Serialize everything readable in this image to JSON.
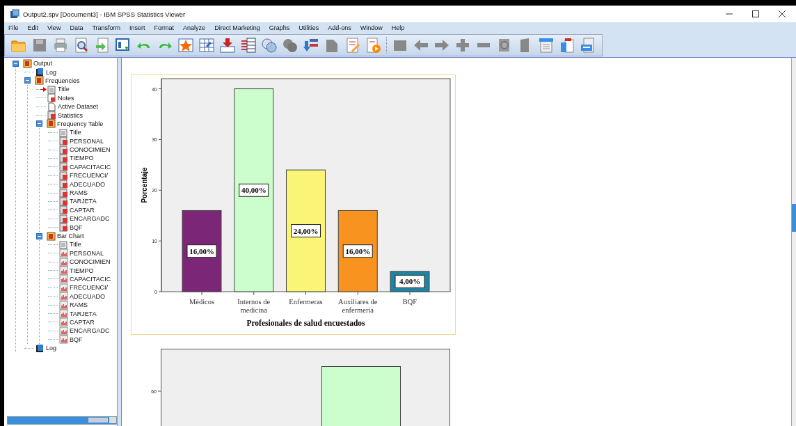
{
  "window": {
    "title": "Output2.spv [Document3] - IBM SPSS Statistics Viewer"
  },
  "menu": [
    "File",
    "Edit",
    "View",
    "Data",
    "Transform",
    "Insert",
    "Format",
    "Analyze",
    "Direct Marketing",
    "Graphs",
    "Utilities",
    "Add-ons",
    "Window",
    "Help"
  ],
  "outline": [
    {
      "label": "Output",
      "kind": "folder",
      "expanded": true,
      "current": false,
      "children": [
        {
          "label": "Log",
          "kind": "log",
          "current": false
        },
        {
          "label": "Frequencies",
          "kind": "folder",
          "expanded": true,
          "current": false,
          "children": [
            {
              "label": "Title",
              "kind": "title",
              "current": true
            },
            {
              "label": "Notes",
              "kind": "notes",
              "current": false
            },
            {
              "label": "Active Dataset",
              "kind": "text",
              "current": false
            },
            {
              "label": "Statistics",
              "kind": "table",
              "current": false
            },
            {
              "label": "Frequency Table",
              "kind": "folder",
              "expanded": true,
              "current": false,
              "children": [
                {
                  "label": "Title",
                  "kind": "title",
                  "current": false
                },
                {
                  "label": "PERSONAL",
                  "kind": "table",
                  "current": false
                },
                {
                  "label": "CONOCIMIEN",
                  "kind": "table",
                  "current": false
                },
                {
                  "label": "TIEMPO",
                  "kind": "table",
                  "current": false
                },
                {
                  "label": "CAPACITACIC",
                  "kind": "table",
                  "current": false
                },
                {
                  "label": "FRECUENCI/",
                  "kind": "table",
                  "current": false
                },
                {
                  "label": "ADECUADO",
                  "kind": "table",
                  "current": false
                },
                {
                  "label": "RAMS",
                  "kind": "table",
                  "current": false
                },
                {
                  "label": "TARJETA",
                  "kind": "table",
                  "current": false
                },
                {
                  "label": "CAPTAR",
                  "kind": "table",
                  "current": false
                },
                {
                  "label": "ENCARGADC",
                  "kind": "table",
                  "current": false
                },
                {
                  "label": "BQF",
                  "kind": "table",
                  "current": false
                }
              ]
            },
            {
              "label": "Bar Chart",
              "kind": "folder",
              "expanded": true,
              "current": false,
              "children": [
                {
                  "label": "Title",
                  "kind": "title",
                  "current": false
                },
                {
                  "label": "PERSONAL",
                  "kind": "chart",
                  "current": false
                },
                {
                  "label": "CONOCIMIEN",
                  "kind": "chart",
                  "current": false
                },
                {
                  "label": "TIEMPO",
                  "kind": "chart",
                  "current": false
                },
                {
                  "label": "CAPACITACIC",
                  "kind": "chart",
                  "current": false
                },
                {
                  "label": "FRECUENCI/",
                  "kind": "chart",
                  "current": false
                },
                {
                  "label": "ADECUADO",
                  "kind": "chart",
                  "current": false
                },
                {
                  "label": "RAMS",
                  "kind": "chart",
                  "current": false
                },
                {
                  "label": "TARJETA",
                  "kind": "chart",
                  "current": false
                },
                {
                  "label": "CAPTAR",
                  "kind": "chart",
                  "current": false
                },
                {
                  "label": "ENCARGADC",
                  "kind": "chart",
                  "current": false
                },
                {
                  "label": "BQF",
                  "kind": "chart",
                  "current": false
                }
              ]
            }
          ]
        },
        {
          "label": "Log",
          "kind": "log",
          "current": false
        }
      ]
    }
  ],
  "bar_chart": {
    "bars": [
      {
        "color": "#7b2677"
      },
      {
        "color": "#ccfdcc"
      },
      {
        "color": "#fbf577"
      },
      {
        "color": "#f7931e"
      },
      {
        "color": "#1f84a2"
      }
    ],
    "chart_data": {
      "type": "bar",
      "xlabel": "Profesionales de salud encuestados",
      "ylabel": "Porcentaje",
      "categories": [
        "Médicos",
        "Internos de medicina",
        "Enfermeras",
        "Auxiliares de enfermería",
        "BQF"
      ],
      "values": [
        16,
        40,
        24,
        16,
        4
      ],
      "ylim": [
        0,
        42
      ],
      "yticks": [
        0,
        10,
        20,
        30,
        40
      ],
      "data_labels": true,
      "value_labels": [
        "16,00%",
        "40,00%",
        "24,00%",
        "16,00%",
        "4,00%"
      ]
    }
  },
  "next_chart": {
    "tick_label": "60"
  }
}
